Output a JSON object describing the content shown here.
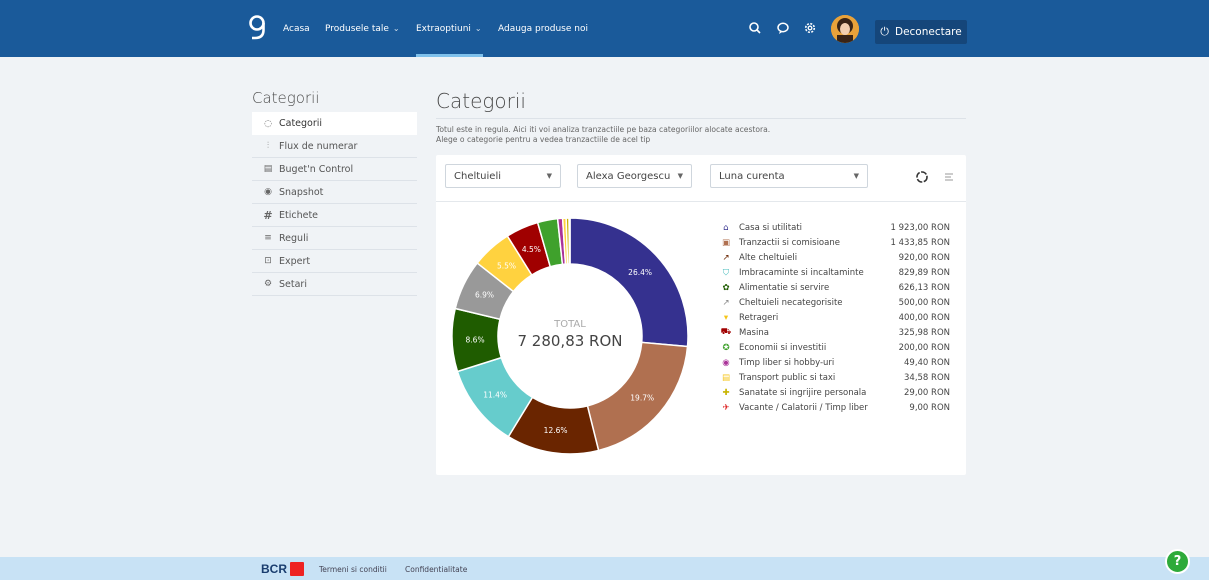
{
  "nav": {
    "home": "Acasa",
    "products": "Produsele tale",
    "extra": "Extraoptiuni",
    "add": "Adauga produse noi",
    "logout": "Deconectare"
  },
  "sidebar": {
    "title": "Categorii",
    "items": [
      {
        "label": "Categorii",
        "icon": "circle-icon"
      },
      {
        "label": "Flux de numerar",
        "icon": "bar-chart-icon"
      },
      {
        "label": "Buget'n Control",
        "icon": "budget-icon"
      },
      {
        "label": "Snapshot",
        "icon": "eye-icon"
      },
      {
        "label": "Etichete",
        "icon": "hashtag-icon"
      },
      {
        "label": "Reguli",
        "icon": "list-icon"
      },
      {
        "label": "Expert",
        "icon": "expert-icon"
      },
      {
        "label": "Setari",
        "icon": "gear-icon"
      }
    ]
  },
  "main": {
    "title": "Categorii",
    "desc1": "Totul este in regula. Aici iti voi analiza tranzactiile pe baza categoriilor alocate acestora.",
    "desc2": "Alege o categorie pentru a vedea tranzactiile de acel tip"
  },
  "filters": {
    "type": "Cheltuieli",
    "person": "Alexa Georgescu",
    "period": "Luna curenta"
  },
  "donut": {
    "total_label": "TOTAL",
    "total_value": "7 280,83 RON"
  },
  "chart_data": {
    "type": "pie",
    "slices": [
      {
        "name": "Casa si utilitati",
        "value": 1923.0,
        "label": "26.4%",
        "color": "#35318f"
      },
      {
        "name": "Tranzactii si comisioane",
        "value": 1433.85,
        "label": "19.7%",
        "color": "#b07050"
      },
      {
        "name": "Alte cheltuieli",
        "value": 920.0,
        "label": "12.6%",
        "color": "#6a2500"
      },
      {
        "name": "Imbracaminte si incaltaminte",
        "value": 829.89,
        "label": "11.4%",
        "color": "#66cccc"
      },
      {
        "name": "Alimentatie si servire",
        "value": 626.13,
        "label": "8.6%",
        "color": "#1f5c00"
      },
      {
        "name": "Cheltuieli necategorisite",
        "value": 500.0,
        "label": "6.9%",
        "color": "#999999"
      },
      {
        "name": "Retrageri",
        "value": 400.0,
        "label": "5.5%",
        "color": "#ffd23f"
      },
      {
        "name": "Masina",
        "value": 325.98,
        "label": "4.5%",
        "color": "#a00000"
      },
      {
        "name": "Economii si investitii",
        "value": 200.0,
        "label": "",
        "color": "#3fa12c"
      },
      {
        "name": "Timp liber si hobby-uri",
        "value": 49.4,
        "label": "",
        "color": "#aa3399"
      },
      {
        "name": "Transport public si taxi",
        "value": 34.58,
        "label": "",
        "color": "#ffd23f"
      },
      {
        "name": "Sanatate si ingrijire personala",
        "value": 29.0,
        "label": "",
        "color": "#c8b400"
      },
      {
        "name": "Vacante / Calatorii / Timp liber",
        "value": 9.0,
        "label": "",
        "color": "#dd2222"
      }
    ]
  },
  "legend": [
    {
      "name": "Casa si utilitati",
      "value": "1 923,00 RON",
      "icon": "house-icon",
      "color": "#35318f",
      "glyph": "⌂"
    },
    {
      "name": "Tranzactii si comisioane",
      "value": "1 433,85 RON",
      "icon": "fee-icon",
      "color": "#b07050",
      "glyph": "▣"
    },
    {
      "name": "Alte cheltuieli",
      "value": "920,00 RON",
      "icon": "arrow-icon",
      "color": "#6a2500",
      "glyph": "↗"
    },
    {
      "name": "Imbracaminte si incaltaminte",
      "value": "829,89 RON",
      "icon": "shirt-icon",
      "color": "#44bbbb",
      "glyph": "⛉"
    },
    {
      "name": "Alimentatie si servire",
      "value": "626,13 RON",
      "icon": "food-icon",
      "color": "#1f5c00",
      "glyph": "✿"
    },
    {
      "name": "Cheltuieli necategorisite",
      "value": "500,00 RON",
      "icon": "uncategorized-icon",
      "color": "#888888",
      "glyph": "↗"
    },
    {
      "name": "Retrageri",
      "value": "400,00 RON",
      "icon": "withdraw-icon",
      "color": "#f5c518",
      "glyph": "▾"
    },
    {
      "name": "Masina",
      "value": "325,98 RON",
      "icon": "car-icon",
      "color": "#a00000",
      "glyph": "⛟"
    },
    {
      "name": "Economii si investitii",
      "value": "200,00 RON",
      "icon": "savings-icon",
      "color": "#3fa12c",
      "glyph": "✪"
    },
    {
      "name": "Timp liber si hobby-uri",
      "value": "49,40 RON",
      "icon": "hobby-icon",
      "color": "#aa3399",
      "glyph": "◉"
    },
    {
      "name": "Transport public si taxi",
      "value": "34,58 RON",
      "icon": "bus-icon",
      "color": "#f5c518",
      "glyph": "▤"
    },
    {
      "name": "Sanatate si ingrijire personala",
      "value": "29,00 RON",
      "icon": "health-icon",
      "color": "#c8b400",
      "glyph": "✚"
    },
    {
      "name": "Vacante / Calatorii / Timp liber",
      "value": "9,00 RON",
      "icon": "vacation-icon",
      "color": "#dd2222",
      "glyph": "✈"
    }
  ],
  "footer": {
    "brand": "BCR",
    "terms": "Termeni si conditii",
    "privacy": "Confidentialitate",
    "help": "?"
  }
}
